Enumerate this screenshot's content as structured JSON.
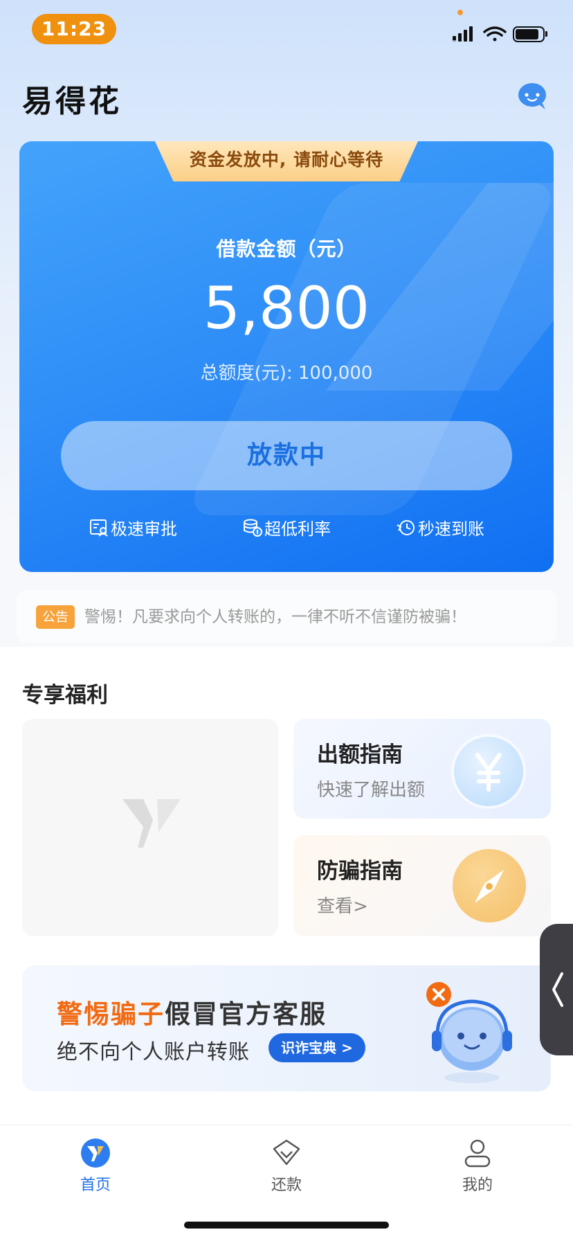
{
  "status_bar": {
    "time": "11:23"
  },
  "header": {
    "title": "易得花",
    "icon": "chat-bubble-icon"
  },
  "loan_card": {
    "ribbon": "资金发放中, 请耐心等待",
    "label": "借款金额（元）",
    "amount": "5,800",
    "total": "总额度(元): 100,000",
    "button": "放款中",
    "features": [
      {
        "label": "极速审批",
        "icon": "approval-icon"
      },
      {
        "label": "超低利率",
        "icon": "coins-icon"
      },
      {
        "label": "秒速到账",
        "icon": "clock-icon"
      }
    ]
  },
  "notice": {
    "tag": "公告",
    "text": "警惕！凡要求向个人转账的，一律不听不信谨防被骗！"
  },
  "benefits": {
    "title": "专享福利",
    "cards": [
      {
        "title": "出额指南",
        "subtitle": "快速了解出额",
        "icon": "yen-icon"
      },
      {
        "title": "防骗指南",
        "subtitle": "查看>",
        "icon": "compass-icon"
      }
    ]
  },
  "banner": {
    "title_highlight": "警惕骗子",
    "title_rest": "假冒官方客服",
    "subtitle": "绝不向个人账户转账",
    "button": "识诈宝典 >"
  },
  "bottom_nav": [
    {
      "label": "首页",
      "icon": "home-logo-icon",
      "active": true
    },
    {
      "label": "还款",
      "icon": "repay-icon",
      "active": false
    },
    {
      "label": "我的",
      "icon": "profile-icon",
      "active": false
    }
  ],
  "colors": {
    "primary": "#1f70e6",
    "accent": "#f26a12",
    "status": "#f0900f"
  }
}
